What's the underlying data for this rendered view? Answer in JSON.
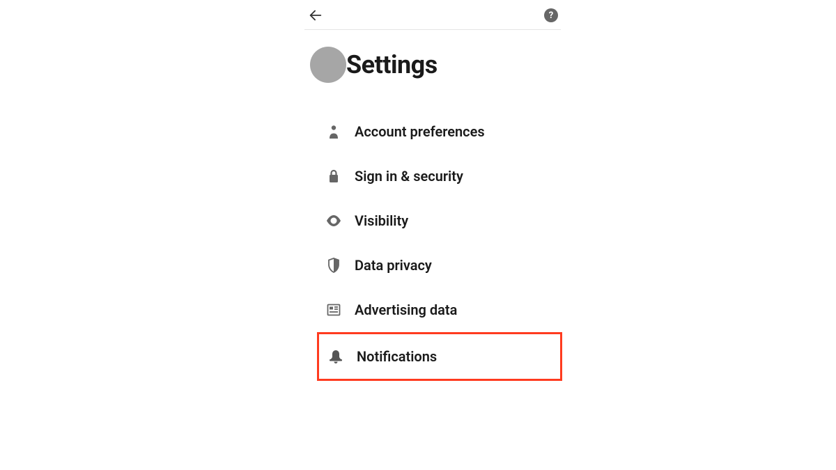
{
  "header": {
    "title": "Settings"
  },
  "menu": {
    "items": [
      {
        "label": "Account preferences"
      },
      {
        "label": "Sign in & security"
      },
      {
        "label": "Visibility"
      },
      {
        "label": "Data privacy"
      },
      {
        "label": "Advertising data"
      },
      {
        "label": "Notifications"
      }
    ]
  },
  "colors": {
    "highlight_border": "#ff3b1f",
    "icon": "#666666",
    "text": "#1a1a1a",
    "avatar_fill": "#a6a6a6"
  }
}
